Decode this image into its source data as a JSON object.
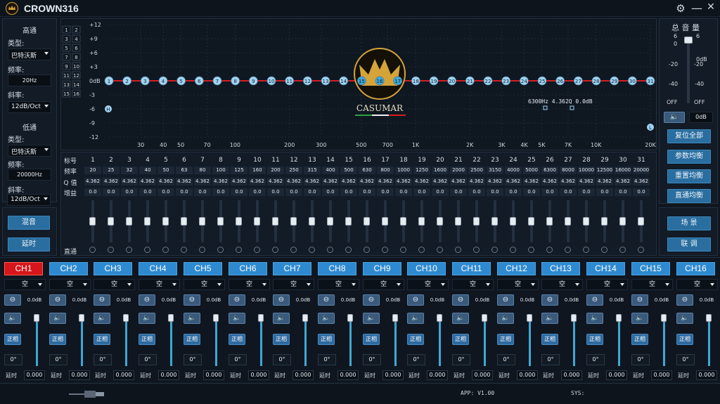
{
  "app": {
    "title": "CROWN316"
  },
  "titlebar": {
    "settings_icon": "gear-icon",
    "minimize_icon": "minimize-icon",
    "close_icon": "close-icon"
  },
  "left": {
    "highpass": {
      "title": "高通",
      "type_label": "类型:",
      "type_value": "巴特沃斯",
      "freq_label": "频率:",
      "freq_value": "20Hz",
      "slope_label": "斜率:",
      "slope_value": "12dB/Oct"
    },
    "lowpass": {
      "title": "低通",
      "type_label": "类型:",
      "type_value": "巴特沃斯",
      "freq_label": "频率:",
      "freq_value": "20000Hz",
      "slope_label": "斜率:",
      "slope_value": "12dB/Oct"
    },
    "mix_button": "混音",
    "delay_button": "延时"
  },
  "graph": {
    "y_ticks": [
      "+12",
      "+9",
      "+6",
      "+3",
      "0dB",
      "-3",
      "-6",
      "-9",
      "-12"
    ],
    "x_ticks": [
      "30",
      "40",
      "50",
      "70",
      "100",
      "200",
      "300",
      "500",
      "700",
      "1K",
      "2K",
      "3K",
      "4K",
      "5K",
      "7K",
      "10K",
      "20K"
    ],
    "channel_selectors": [
      "1",
      "2",
      "3",
      "4",
      "5",
      "6",
      "7",
      "8",
      "9",
      "10",
      "11",
      "12",
      "13",
      "14",
      "15",
      "16"
    ],
    "point_labels": [
      "1",
      "2",
      "3",
      "4",
      "5",
      "6",
      "7",
      "8",
      "9",
      "10",
      "11",
      "12",
      "13",
      "14",
      "15",
      "16",
      "17",
      "18",
      "19",
      "20",
      "21",
      "22",
      "23",
      "24",
      "25",
      "26",
      "27",
      "28",
      "29",
      "30",
      "31"
    ],
    "h_marker": "H",
    "l_marker": "L",
    "readout": "6300Hz 4.362Q 0.0dB",
    "brand": "CASUMAR",
    "colors": {
      "curve": "#d61e22",
      "point": "#9fd3f1",
      "active_point": "#3fa7d6",
      "grid": "#2a3a4c",
      "accent": "#d4a43a"
    }
  },
  "eq_table": {
    "row_labels": {
      "index": "标号",
      "freq": "频率",
      "q": "Q 值",
      "gain": "增益",
      "bypass": "直通"
    },
    "bands": [
      "1",
      "2",
      "3",
      "4",
      "5",
      "6",
      "7",
      "8",
      "9",
      "10",
      "11",
      "12",
      "13",
      "14",
      "15",
      "16",
      "17",
      "18",
      "19",
      "20",
      "21",
      "22",
      "23",
      "24",
      "25",
      "26",
      "27",
      "28",
      "29",
      "30",
      "31"
    ],
    "freqs": [
      "20",
      "25",
      "32",
      "40",
      "50",
      "63",
      "80",
      "100",
      "125",
      "160",
      "200",
      "250",
      "315",
      "400",
      "500",
      "630",
      "800",
      "1000",
      "1250",
      "1600",
      "2000",
      "2500",
      "3150",
      "4000",
      "5000",
      "6300",
      "8000",
      "10000",
      "12500",
      "16000",
      "20000"
    ],
    "q_value": "4.362",
    "gain_value": "0.0"
  },
  "right": {
    "title": "总 音 量",
    "scale_left": [
      "6",
      "0",
      "-20",
      "-40",
      "OFF"
    ],
    "scale_right": [
      "6",
      "0dB",
      "-20",
      "-40",
      "OFF"
    ],
    "master_volume_level_db": 6,
    "mute_icon": "speaker-icon",
    "master_gain": "0dB",
    "buttons": [
      "复位全部",
      "参数均衡",
      "重置均衡",
      "直通均衡"
    ],
    "scene_button": "场 景",
    "link_button": "联 调"
  },
  "channels": {
    "names": [
      "CH1",
      "CH2",
      "CH3",
      "CH4",
      "CH5",
      "CH6",
      "CH7",
      "CH8",
      "CH9",
      "CH10",
      "CH11",
      "CH12",
      "CH13",
      "CH14",
      "CH15",
      "CH16"
    ],
    "active_index": 0,
    "source_value": "空",
    "gain_value": "0.0dB",
    "phase_label": "正相",
    "phase_deg": "0°",
    "delay_label": "延时",
    "delay_value": "0.000",
    "link_icon": "link-icon",
    "speaker_icon": "speaker-icon",
    "fader_level": 1.0
  },
  "status": {
    "app_version": "APP: V1.00",
    "sys": "SYS:",
    "usb_icon": "usb-icon"
  }
}
